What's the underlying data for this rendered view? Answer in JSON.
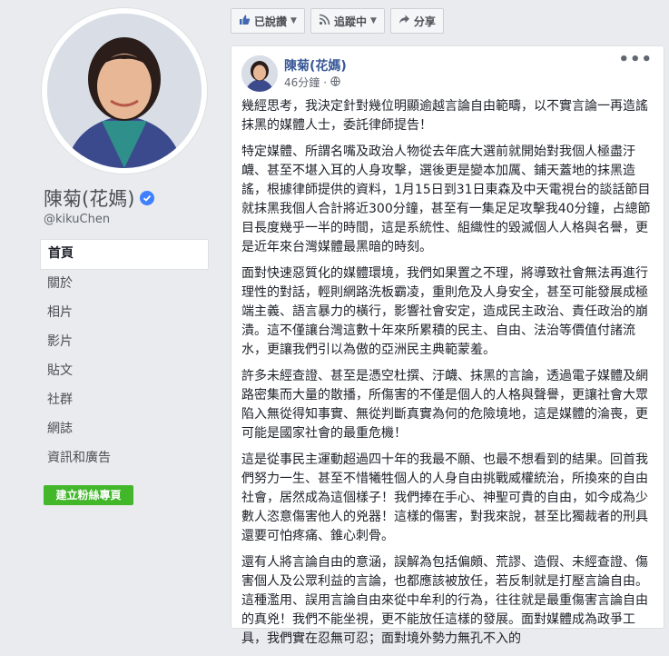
{
  "profile": {
    "name": "陳菊(花媽)",
    "handle": "@kikuChen",
    "nav": [
      "首頁",
      "關於",
      "相片",
      "影片",
      "貼文",
      "社群",
      "網誌",
      "資訊和廣告"
    ],
    "create_page_label": "建立粉絲專頁"
  },
  "actions": {
    "liked_label": "已說讚",
    "following_label": "追蹤中",
    "share_label": "分享"
  },
  "post": {
    "author": "陳菊(花媽)",
    "time": "46分鐘",
    "paragraphs": [
      "幾經思考，我決定針對幾位明顯逾越言論自由範疇，以不實言論一再造謠抹黑的媒體人士，委託律師提告！",
      "特定媒體、所謂名嘴及政治人物從去年底大選前就開始對我個人極盡汙衊、甚至不堪入耳的人身攻擊，選後更是變本加厲、鋪天蓋地的抹黑造謠，根據律師提供的資料，1月15日到31日東森及中天電視台的談話節目就抹黑我個人合計將近300分鐘，甚至有一集足足攻擊我40分鐘，占總節目長度幾乎一半的時間，這是系統性、組織性的毀滅個人人格與名譽，更是近年來台灣媒體最黑暗的時刻。",
      "面對快速惡質化的媒體環境，我們如果置之不理，將導致社會無法再進行理性的對話，輕則網路洗板霸凌，重則危及人身安全，甚至可能發展成極端主義、語言暴力的橫行，影響社會安定，造成民主政治、責任政治的崩潰。這不僅讓台灣這數十年來所累積的民主、自由、法治等價值付諸流水，更讓我們引以為傲的亞洲民主典範蒙羞。",
      "許多未經查證、甚至是憑空杜撰、汙衊、抹黑的言論，透過電子媒體及網路密集而大量的散播，所傷害的不僅是個人的人格與聲譽，更讓社會大眾陷入無從得知事實、無從判斷真實為何的危險境地，這是媒體的淪喪，更可能是國家社會的最重危機！",
      "這是從事民主運動超過四十年的我最不願、也最不想看到的結果。回首我們努力一生、甚至不惜犧牲個人的人身自由挑戰威權統治，所換來的自由社會，居然成為這個樣子！我們捧在手心、神聖可貴的自由，如今成為少數人恣意傷害他人的兇器！這樣的傷害，對我來說，甚至比獨裁者的刑具還要可怕疼痛、錐心刺骨。",
      "還有人將言論自由的意涵，誤解為包括偏頗、荒謬、造假、未經查證、傷害個人及公眾利益的言論，也都應該被放任，若反制就是打壓言論自由。這種濫用、誤用言論自由來從中牟利的行為，往往就是最重傷害言論自由的真兇！我們不能坐視，更不能放任這樣的發展。面對媒體成為政爭工具，我們實在忍無可忍；面對境外勢力無孔不入的"
    ]
  },
  "colors": {
    "accent": "#385898",
    "green": "#42b72a",
    "verified": "#4080ff"
  },
  "icons": [
    "verified-icon",
    "thumbs-up-icon",
    "rss-icon",
    "share-arrow-icon",
    "globe-icon",
    "more-icon"
  ]
}
